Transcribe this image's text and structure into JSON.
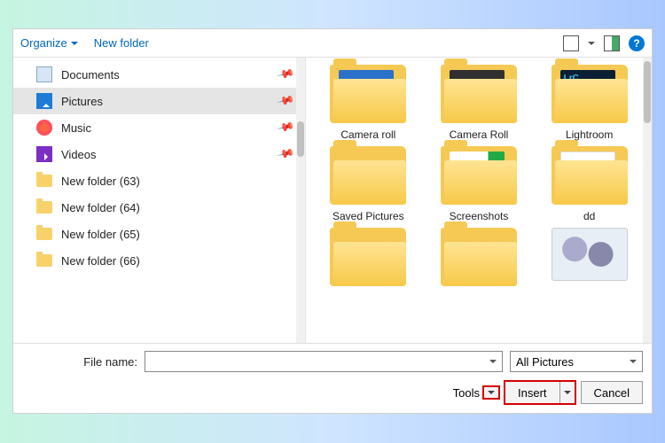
{
  "toolbar": {
    "organize": "Organize",
    "new_folder": "New folder",
    "help": "?"
  },
  "nav": {
    "items": [
      {
        "label": "Documents",
        "icon": "doc",
        "pinned": true,
        "selected": false
      },
      {
        "label": "Pictures",
        "icon": "pic",
        "pinned": true,
        "selected": true
      },
      {
        "label": "Music",
        "icon": "music",
        "pinned": true,
        "selected": false
      },
      {
        "label": "Videos",
        "icon": "video",
        "pinned": true,
        "selected": false
      },
      {
        "label": "New folder (63)",
        "icon": "folder",
        "pinned": false,
        "selected": false
      },
      {
        "label": "New folder (64)",
        "icon": "folder",
        "pinned": false,
        "selected": false
      },
      {
        "label": "New folder (65)",
        "icon": "folder",
        "pinned": false,
        "selected": false
      },
      {
        "label": "New folder (66)",
        "icon": "folder",
        "pinned": false,
        "selected": false
      }
    ]
  },
  "content": {
    "items": [
      {
        "label": "Camera roll",
        "kind": "folder",
        "peek": "blue"
      },
      {
        "label": "Camera Roll",
        "kind": "folder",
        "peek": "dark"
      },
      {
        "label": "Lightroom",
        "kind": "folder",
        "peek": "lrc"
      },
      {
        "label": "Saved Pictures",
        "kind": "folder",
        "peek": ""
      },
      {
        "label": "Screenshots",
        "kind": "folder",
        "peek": "shot"
      },
      {
        "label": "dd",
        "kind": "folder",
        "peek": "white"
      },
      {
        "label": "",
        "kind": "folder",
        "peek": ""
      },
      {
        "label": "",
        "kind": "folder",
        "peek": ""
      },
      {
        "label": "",
        "kind": "image",
        "peek": ""
      }
    ]
  },
  "footer": {
    "filename_label": "File name:",
    "filename_value": "",
    "filter_label": "All Pictures",
    "tools": "Tools",
    "insert": "Insert",
    "cancel": "Cancel"
  }
}
